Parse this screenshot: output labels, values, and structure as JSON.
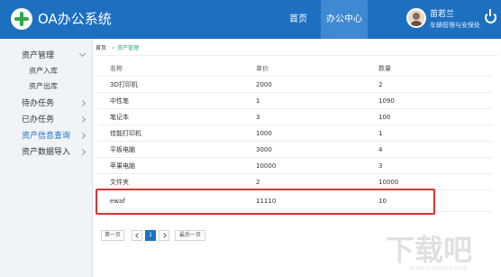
{
  "app": {
    "title": "OA办公系统"
  },
  "nav": {
    "home": "首页",
    "office": "办公中心"
  },
  "user": {
    "name": "苗若兰",
    "role": "车辆管理与安保处"
  },
  "sidebar": {
    "items": [
      {
        "label": "资产管理"
      },
      {
        "label": "资产入库"
      },
      {
        "label": "资产出库"
      },
      {
        "label": "待办任务"
      },
      {
        "label": "已办任务"
      },
      {
        "label": "资产信息查询"
      },
      {
        "label": "资产数据导入"
      }
    ]
  },
  "breadcrumb": {
    "home": "首页",
    "sep": "»",
    "current": "资产管理"
  },
  "table": {
    "headers": [
      "名称",
      "单价",
      "数量"
    ],
    "rows": [
      [
        "3D打印机",
        "2000",
        "2"
      ],
      [
        "中性笔",
        "1",
        "1090"
      ],
      [
        "笔记本",
        "3",
        "100"
      ],
      [
        "佳能打印机",
        "1000",
        "1"
      ],
      [
        "平板电脑",
        "3000",
        "4"
      ],
      [
        "苹果电脑",
        "10000",
        "3"
      ],
      [
        "文件夹",
        "2",
        "10000"
      ],
      [
        "ewaf",
        "11110",
        "10"
      ]
    ]
  },
  "pager": {
    "first": "第一页",
    "current": "1",
    "last": "最后一页"
  },
  "colors": {
    "topbar": "#1d6fc0",
    "active_nav": "#3f88d2",
    "highlight": "#e03030",
    "breadcrumb_current": "#2aa87a"
  }
}
